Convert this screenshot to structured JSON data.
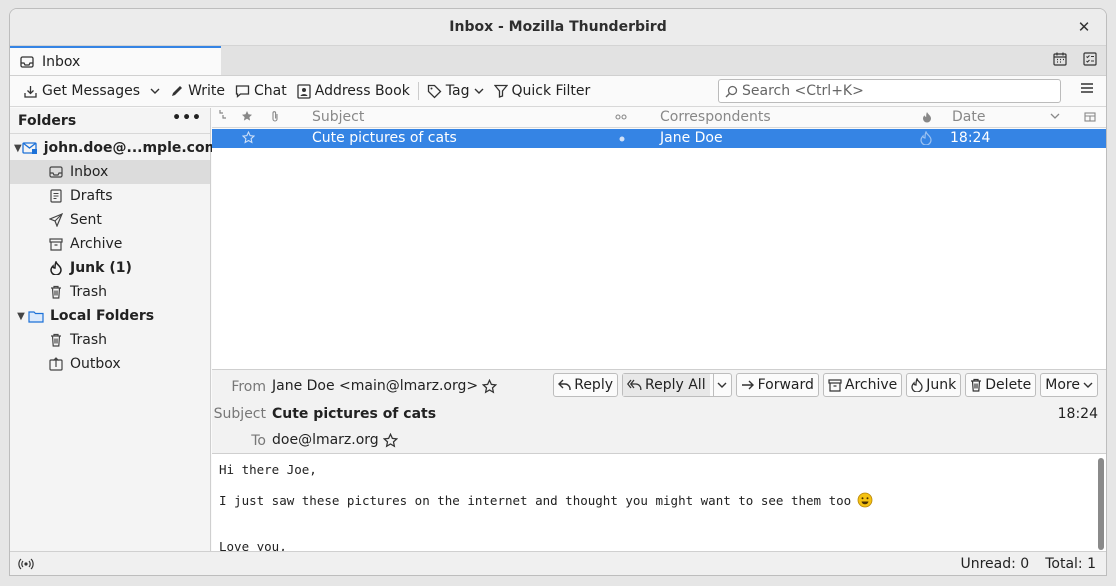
{
  "window": {
    "title": "Inbox - Mozilla Thunderbird"
  },
  "tabs": [
    {
      "label": "Inbox"
    }
  ],
  "toolbar": {
    "get_messages": "Get Messages",
    "write": "Write",
    "chat": "Chat",
    "address_book": "Address Book",
    "tag": "Tag",
    "quick_filter": "Quick Filter",
    "search_placeholder": "Search <Ctrl+K>"
  },
  "folders": {
    "header": "Folders",
    "account": "john.doe@...mple.com",
    "items": [
      {
        "label": "Inbox",
        "icon": "inbox-icon"
      },
      {
        "label": "Drafts",
        "icon": "drafts-icon"
      },
      {
        "label": "Sent",
        "icon": "sent-icon"
      },
      {
        "label": "Archive",
        "icon": "archive-icon"
      },
      {
        "label": "Junk (1)",
        "icon": "junk-icon"
      },
      {
        "label": "Trash",
        "icon": "trash-icon"
      }
    ],
    "local": "Local Folders",
    "local_items": [
      {
        "label": "Trash",
        "icon": "trash-icon"
      },
      {
        "label": "Outbox",
        "icon": "outbox-icon"
      }
    ]
  },
  "thread_columns": {
    "subject": "Subject",
    "correspondents": "Correspondents",
    "date": "Date"
  },
  "messages": [
    {
      "subject": "Cute pictures of cats",
      "correspondent": "Jane Doe",
      "date": "18:24"
    }
  ],
  "message_header": {
    "from_label": "From",
    "from": "Jane Doe <main@lmarz.org>",
    "subject_label": "Subject",
    "subject": "Cute pictures of cats",
    "to_label": "To",
    "to": "doe@lmarz.org",
    "time": "18:24",
    "actions": {
      "reply": "Reply",
      "reply_all": "Reply All",
      "forward": "Forward",
      "archive": "Archive",
      "junk": "Junk",
      "delete": "Delete",
      "more": "More"
    }
  },
  "message_body": {
    "line1": "Hi there Joe,",
    "line2": "I just saw these pictures on the internet and thought you might want to see them too",
    "line3": "Love you,"
  },
  "status": {
    "unread": "Unread: 0",
    "total": "Total: 1"
  }
}
